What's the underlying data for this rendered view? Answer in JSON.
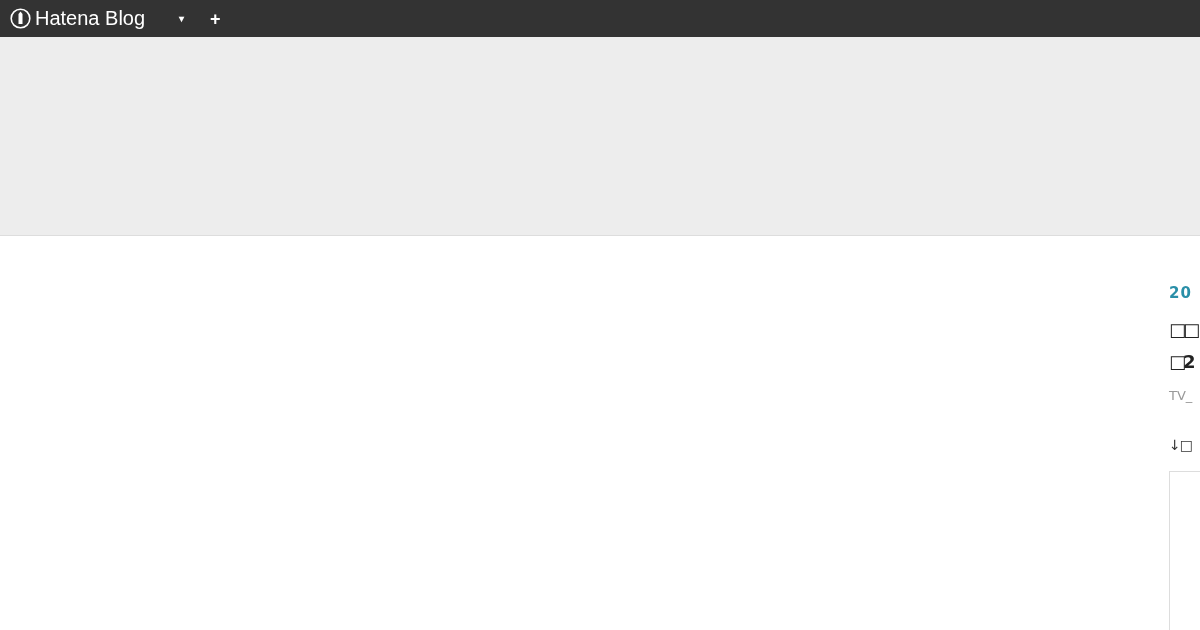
{
  "top_bar": {
    "logo": "Hatena Blog",
    "menu_caret": "▾",
    "add": "+"
  },
  "entry": {
    "date": "20",
    "title_lines": [
      "□□",
      "□2"
    ],
    "category": "TV_",
    "lead": "↓□"
  }
}
